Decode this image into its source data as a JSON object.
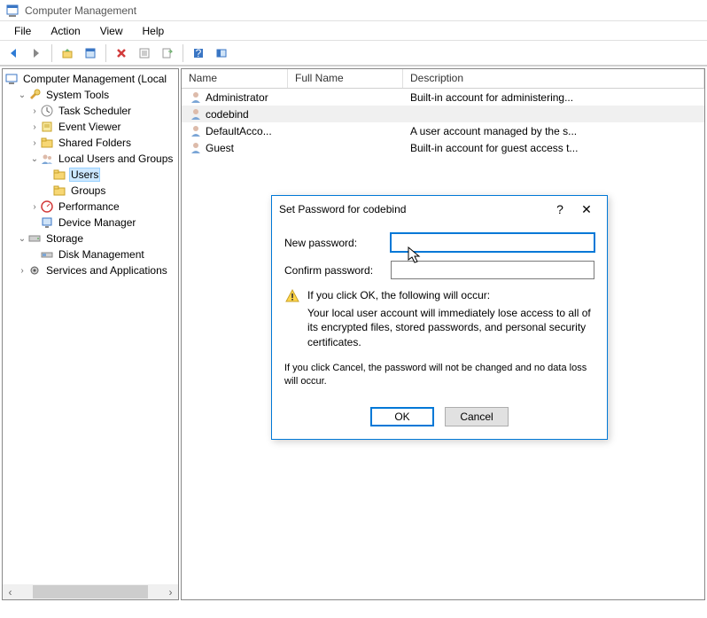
{
  "window": {
    "title": "Computer Management"
  },
  "menubar": [
    "File",
    "Action",
    "View",
    "Help"
  ],
  "tree": {
    "root": "Computer Management (Local",
    "system_tools": "System Tools",
    "task_scheduler": "Task Scheduler",
    "event_viewer": "Event Viewer",
    "shared_folders": "Shared Folders",
    "local_users_groups": "Local Users and Groups",
    "users": "Users",
    "groups": "Groups",
    "performance": "Performance",
    "device_manager": "Device Manager",
    "storage": "Storage",
    "disk_management": "Disk Management",
    "services_apps": "Services and Applications"
  },
  "columns": {
    "name": "Name",
    "fullname": "Full Name",
    "desc": "Description"
  },
  "rows": [
    {
      "name": "Administrator",
      "fullname": "",
      "desc": "Built-in account for administering..."
    },
    {
      "name": "codebind",
      "fullname": "",
      "desc": ""
    },
    {
      "name": "DefaultAcco...",
      "fullname": "",
      "desc": "A user account managed by the s..."
    },
    {
      "name": "Guest",
      "fullname": "",
      "desc": "Built-in account for guest access t..."
    }
  ],
  "dialog": {
    "title": "Set Password for codebind",
    "new_password": "New password:",
    "confirm_password": "Confirm password:",
    "help": "?",
    "close": "✕",
    "warn_heading": "If you click OK, the following will occur:",
    "warn_body": "Your local user account will immediately lose access to all of its encrypted files, stored passwords, and personal security certificates.",
    "info": "If you click Cancel, the password will not be changed and no data loss will occur.",
    "ok": "OK",
    "cancel": "Cancel"
  }
}
